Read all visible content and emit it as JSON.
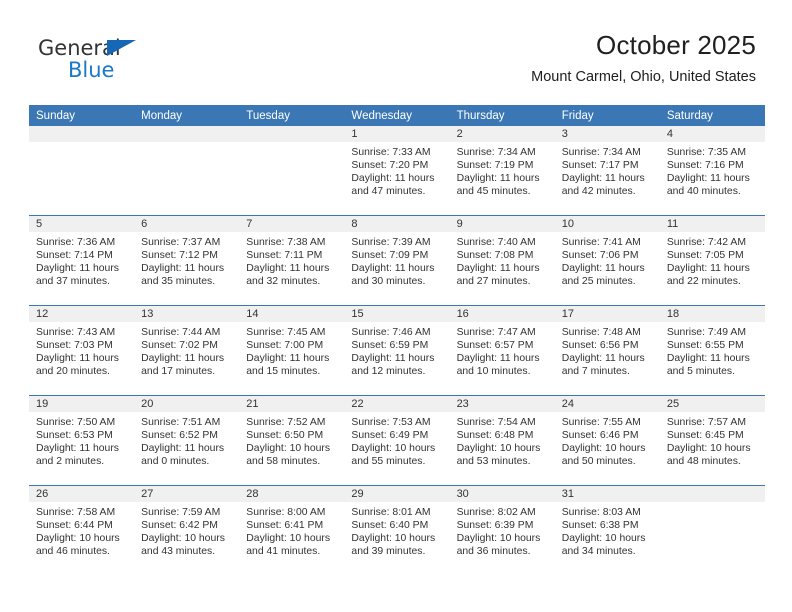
{
  "brand": {
    "name_top": "General",
    "name_bottom": "Blue",
    "triangle_color": "#1667b5",
    "text_color": "#333333",
    "accent_color": "#1b79c8"
  },
  "header": {
    "title": "October 2025",
    "subtitle": "Mount Carmel, Ohio, United States"
  },
  "theme": {
    "header_blue": "#3b77b4",
    "daynum_band": "#f0f0f0",
    "text": "#333333"
  },
  "weekdays": [
    "Sunday",
    "Monday",
    "Tuesday",
    "Wednesday",
    "Thursday",
    "Friday",
    "Saturday"
  ],
  "weeks": [
    [
      {
        "day": "",
        "sunrise": "",
        "sunset": "",
        "daylight_1": "",
        "daylight_2": ""
      },
      {
        "day": "",
        "sunrise": "",
        "sunset": "",
        "daylight_1": "",
        "daylight_2": ""
      },
      {
        "day": "",
        "sunrise": "",
        "sunset": "",
        "daylight_1": "",
        "daylight_2": ""
      },
      {
        "day": "1",
        "sunrise": "Sunrise: 7:33 AM",
        "sunset": "Sunset: 7:20 PM",
        "daylight_1": "Daylight: 11 hours",
        "daylight_2": "and 47 minutes."
      },
      {
        "day": "2",
        "sunrise": "Sunrise: 7:34 AM",
        "sunset": "Sunset: 7:19 PM",
        "daylight_1": "Daylight: 11 hours",
        "daylight_2": "and 45 minutes."
      },
      {
        "day": "3",
        "sunrise": "Sunrise: 7:34 AM",
        "sunset": "Sunset: 7:17 PM",
        "daylight_1": "Daylight: 11 hours",
        "daylight_2": "and 42 minutes."
      },
      {
        "day": "4",
        "sunrise": "Sunrise: 7:35 AM",
        "sunset": "Sunset: 7:16 PM",
        "daylight_1": "Daylight: 11 hours",
        "daylight_2": "and 40 minutes."
      }
    ],
    [
      {
        "day": "5",
        "sunrise": "Sunrise: 7:36 AM",
        "sunset": "Sunset: 7:14 PM",
        "daylight_1": "Daylight: 11 hours",
        "daylight_2": "and 37 minutes."
      },
      {
        "day": "6",
        "sunrise": "Sunrise: 7:37 AM",
        "sunset": "Sunset: 7:12 PM",
        "daylight_1": "Daylight: 11 hours",
        "daylight_2": "and 35 minutes."
      },
      {
        "day": "7",
        "sunrise": "Sunrise: 7:38 AM",
        "sunset": "Sunset: 7:11 PM",
        "daylight_1": "Daylight: 11 hours",
        "daylight_2": "and 32 minutes."
      },
      {
        "day": "8",
        "sunrise": "Sunrise: 7:39 AM",
        "sunset": "Sunset: 7:09 PM",
        "daylight_1": "Daylight: 11 hours",
        "daylight_2": "and 30 minutes."
      },
      {
        "day": "9",
        "sunrise": "Sunrise: 7:40 AM",
        "sunset": "Sunset: 7:08 PM",
        "daylight_1": "Daylight: 11 hours",
        "daylight_2": "and 27 minutes."
      },
      {
        "day": "10",
        "sunrise": "Sunrise: 7:41 AM",
        "sunset": "Sunset: 7:06 PM",
        "daylight_1": "Daylight: 11 hours",
        "daylight_2": "and 25 minutes."
      },
      {
        "day": "11",
        "sunrise": "Sunrise: 7:42 AM",
        "sunset": "Sunset: 7:05 PM",
        "daylight_1": "Daylight: 11 hours",
        "daylight_2": "and 22 minutes."
      }
    ],
    [
      {
        "day": "12",
        "sunrise": "Sunrise: 7:43 AM",
        "sunset": "Sunset: 7:03 PM",
        "daylight_1": "Daylight: 11 hours",
        "daylight_2": "and 20 minutes."
      },
      {
        "day": "13",
        "sunrise": "Sunrise: 7:44 AM",
        "sunset": "Sunset: 7:02 PM",
        "daylight_1": "Daylight: 11 hours",
        "daylight_2": "and 17 minutes."
      },
      {
        "day": "14",
        "sunrise": "Sunrise: 7:45 AM",
        "sunset": "Sunset: 7:00 PM",
        "daylight_1": "Daylight: 11 hours",
        "daylight_2": "and 15 minutes."
      },
      {
        "day": "15",
        "sunrise": "Sunrise: 7:46 AM",
        "sunset": "Sunset: 6:59 PM",
        "daylight_1": "Daylight: 11 hours",
        "daylight_2": "and 12 minutes."
      },
      {
        "day": "16",
        "sunrise": "Sunrise: 7:47 AM",
        "sunset": "Sunset: 6:57 PM",
        "daylight_1": "Daylight: 11 hours",
        "daylight_2": "and 10 minutes."
      },
      {
        "day": "17",
        "sunrise": "Sunrise: 7:48 AM",
        "sunset": "Sunset: 6:56 PM",
        "daylight_1": "Daylight: 11 hours",
        "daylight_2": "and 7 minutes."
      },
      {
        "day": "18",
        "sunrise": "Sunrise: 7:49 AM",
        "sunset": "Sunset: 6:55 PM",
        "daylight_1": "Daylight: 11 hours",
        "daylight_2": "and 5 minutes."
      }
    ],
    [
      {
        "day": "19",
        "sunrise": "Sunrise: 7:50 AM",
        "sunset": "Sunset: 6:53 PM",
        "daylight_1": "Daylight: 11 hours",
        "daylight_2": "and 2 minutes."
      },
      {
        "day": "20",
        "sunrise": "Sunrise: 7:51 AM",
        "sunset": "Sunset: 6:52 PM",
        "daylight_1": "Daylight: 11 hours",
        "daylight_2": "and 0 minutes."
      },
      {
        "day": "21",
        "sunrise": "Sunrise: 7:52 AM",
        "sunset": "Sunset: 6:50 PM",
        "daylight_1": "Daylight: 10 hours",
        "daylight_2": "and 58 minutes."
      },
      {
        "day": "22",
        "sunrise": "Sunrise: 7:53 AM",
        "sunset": "Sunset: 6:49 PM",
        "daylight_1": "Daylight: 10 hours",
        "daylight_2": "and 55 minutes."
      },
      {
        "day": "23",
        "sunrise": "Sunrise: 7:54 AM",
        "sunset": "Sunset: 6:48 PM",
        "daylight_1": "Daylight: 10 hours",
        "daylight_2": "and 53 minutes."
      },
      {
        "day": "24",
        "sunrise": "Sunrise: 7:55 AM",
        "sunset": "Sunset: 6:46 PM",
        "daylight_1": "Daylight: 10 hours",
        "daylight_2": "and 50 minutes."
      },
      {
        "day": "25",
        "sunrise": "Sunrise: 7:57 AM",
        "sunset": "Sunset: 6:45 PM",
        "daylight_1": "Daylight: 10 hours",
        "daylight_2": "and 48 minutes."
      }
    ],
    [
      {
        "day": "26",
        "sunrise": "Sunrise: 7:58 AM",
        "sunset": "Sunset: 6:44 PM",
        "daylight_1": "Daylight: 10 hours",
        "daylight_2": "and 46 minutes."
      },
      {
        "day": "27",
        "sunrise": "Sunrise: 7:59 AM",
        "sunset": "Sunset: 6:42 PM",
        "daylight_1": "Daylight: 10 hours",
        "daylight_2": "and 43 minutes."
      },
      {
        "day": "28",
        "sunrise": "Sunrise: 8:00 AM",
        "sunset": "Sunset: 6:41 PM",
        "daylight_1": "Daylight: 10 hours",
        "daylight_2": "and 41 minutes."
      },
      {
        "day": "29",
        "sunrise": "Sunrise: 8:01 AM",
        "sunset": "Sunset: 6:40 PM",
        "daylight_1": "Daylight: 10 hours",
        "daylight_2": "and 39 minutes."
      },
      {
        "day": "30",
        "sunrise": "Sunrise: 8:02 AM",
        "sunset": "Sunset: 6:39 PM",
        "daylight_1": "Daylight: 10 hours",
        "daylight_2": "and 36 minutes."
      },
      {
        "day": "31",
        "sunrise": "Sunrise: 8:03 AM",
        "sunset": "Sunset: 6:38 PM",
        "daylight_1": "Daylight: 10 hours",
        "daylight_2": "and 34 minutes."
      },
      {
        "day": "",
        "sunrise": "",
        "sunset": "",
        "daylight_1": "",
        "daylight_2": ""
      }
    ]
  ]
}
